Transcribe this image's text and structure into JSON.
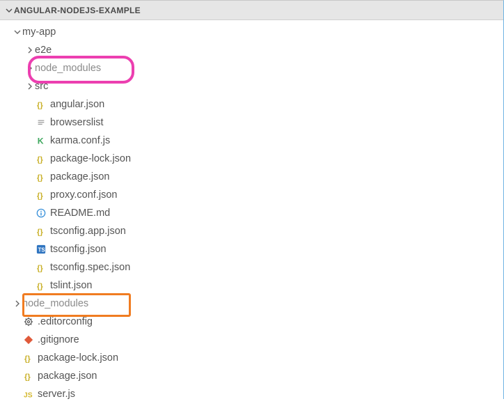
{
  "panel": {
    "title": "ANGULAR-NODEJS-EXAMPLE"
  },
  "tree": [
    {
      "id": "my-app",
      "label": "my-app",
      "depth": 0,
      "kind": "folder-open",
      "expanded": true,
      "muted": false,
      "highlight": null
    },
    {
      "id": "e2e",
      "label": "e2e",
      "depth": 1,
      "kind": "folder",
      "expanded": false,
      "muted": false,
      "highlight": null
    },
    {
      "id": "node_modules_1",
      "label": "node_modules",
      "depth": 1,
      "kind": "folder",
      "expanded": false,
      "muted": true,
      "highlight": "pink"
    },
    {
      "id": "src",
      "label": "src",
      "depth": 1,
      "kind": "folder",
      "expanded": false,
      "muted": false,
      "highlight": null
    },
    {
      "id": "angular.json",
      "label": "angular.json",
      "depth": 1,
      "kind": "json",
      "expanded": null,
      "muted": false,
      "highlight": null
    },
    {
      "id": "browserslist",
      "label": "browserslist",
      "depth": 1,
      "kind": "text",
      "expanded": null,
      "muted": false,
      "highlight": null
    },
    {
      "id": "karma.conf.js",
      "label": "karma.conf.js",
      "depth": 1,
      "kind": "karma",
      "expanded": null,
      "muted": false,
      "highlight": null
    },
    {
      "id": "package-lock.json",
      "label": "package-lock.json",
      "depth": 1,
      "kind": "json",
      "expanded": null,
      "muted": false,
      "highlight": null
    },
    {
      "id": "package.json",
      "label": "package.json",
      "depth": 1,
      "kind": "json",
      "expanded": null,
      "muted": false,
      "highlight": null
    },
    {
      "id": "proxy.conf.json",
      "label": "proxy.conf.json",
      "depth": 1,
      "kind": "json",
      "expanded": null,
      "muted": false,
      "highlight": null
    },
    {
      "id": "README.md",
      "label": "README.md",
      "depth": 1,
      "kind": "info",
      "expanded": null,
      "muted": false,
      "highlight": null
    },
    {
      "id": "tsconfig.app.json",
      "label": "tsconfig.app.json",
      "depth": 1,
      "kind": "json",
      "expanded": null,
      "muted": false,
      "highlight": null
    },
    {
      "id": "tsconfig.json",
      "label": "tsconfig.json",
      "depth": 1,
      "kind": "ts",
      "expanded": null,
      "muted": false,
      "highlight": null
    },
    {
      "id": "tsconfig.spec.json",
      "label": "tsconfig.spec.json",
      "depth": 1,
      "kind": "json",
      "expanded": null,
      "muted": false,
      "highlight": null
    },
    {
      "id": "tslint.json",
      "label": "tslint.json",
      "depth": 1,
      "kind": "json",
      "expanded": null,
      "muted": false,
      "highlight": null
    },
    {
      "id": "node_modules_2",
      "label": "node_modules",
      "depth": 0,
      "kind": "folder",
      "expanded": false,
      "muted": true,
      "highlight": "orange"
    },
    {
      "id": "editorconfig",
      "label": ".editorconfig",
      "depth": 0,
      "kind": "gear",
      "expanded": null,
      "muted": false,
      "highlight": null
    },
    {
      "id": "gitignore",
      "label": ".gitignore",
      "depth": 0,
      "kind": "git",
      "expanded": null,
      "muted": false,
      "highlight": null
    },
    {
      "id": "root-package-lock",
      "label": "package-lock.json",
      "depth": 0,
      "kind": "json",
      "expanded": null,
      "muted": false,
      "highlight": null
    },
    {
      "id": "root-package",
      "label": "package.json",
      "depth": 0,
      "kind": "json",
      "expanded": null,
      "muted": false,
      "highlight": null
    },
    {
      "id": "server.js",
      "label": "server.js",
      "depth": 0,
      "kind": "js",
      "expanded": null,
      "muted": false,
      "highlight": null
    }
  ]
}
